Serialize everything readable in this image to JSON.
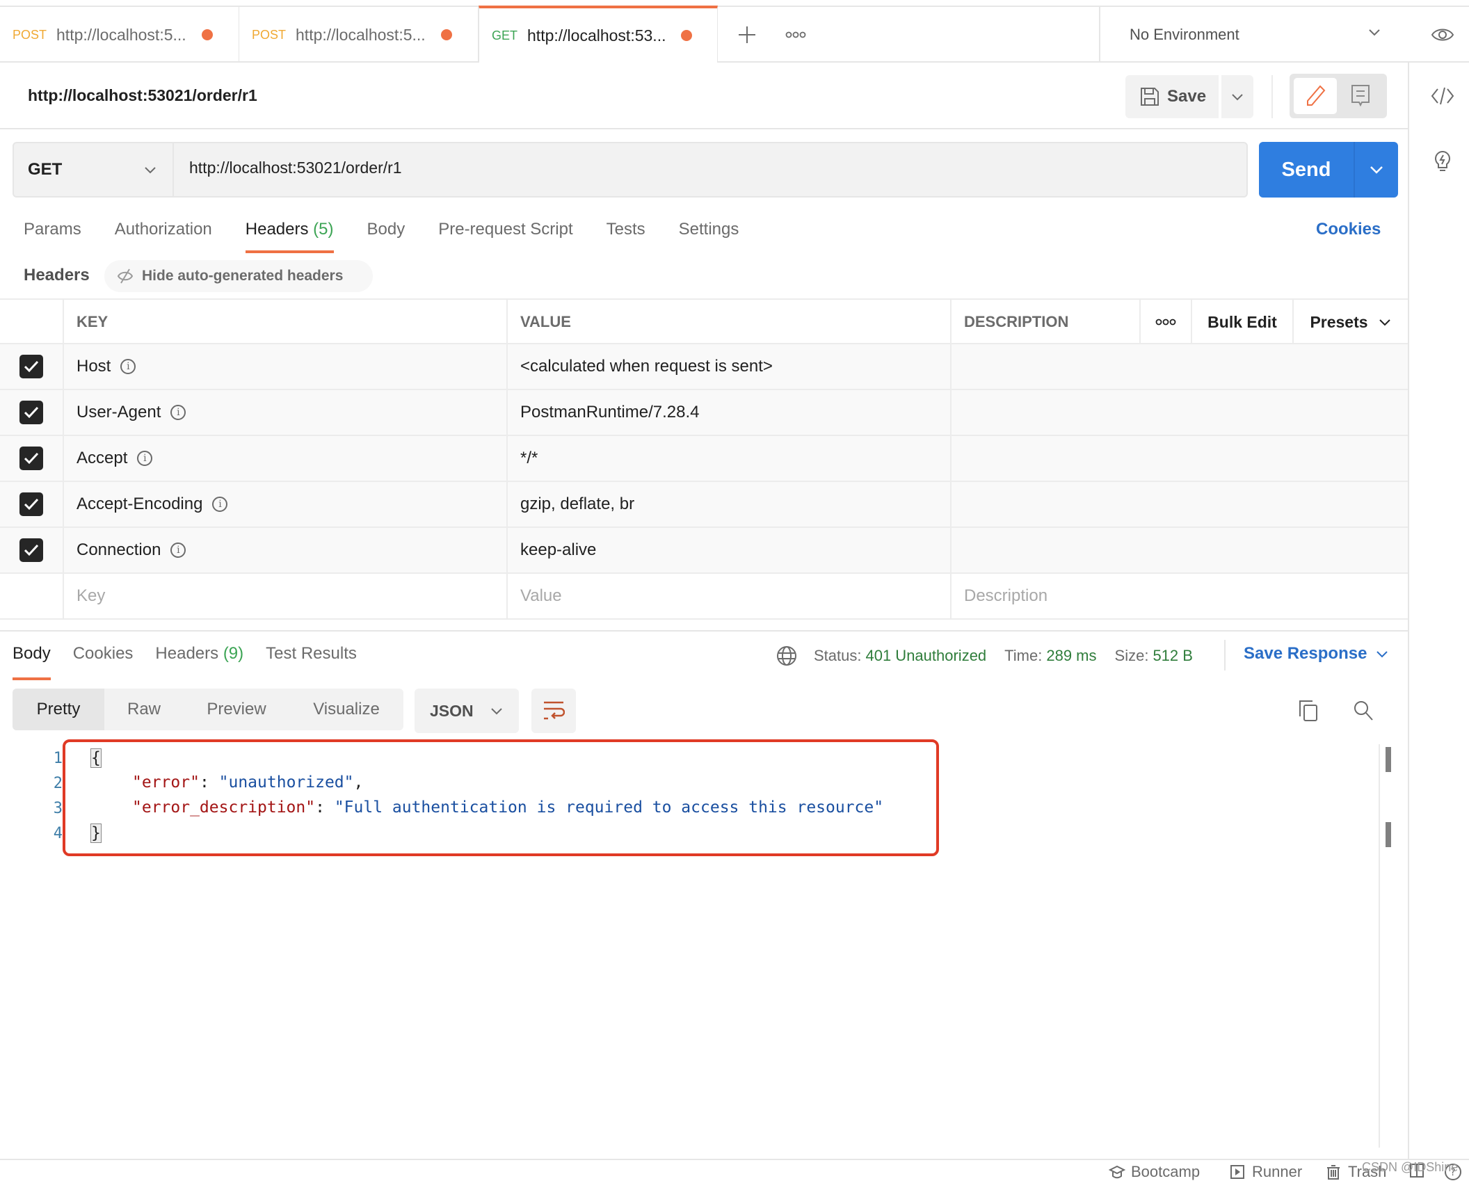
{
  "tabs": [
    {
      "method": "POST",
      "title": "http://localhost:5...",
      "unsaved": true,
      "active": false
    },
    {
      "method": "POST",
      "title": "http://localhost:5...",
      "unsaved": true,
      "active": false
    },
    {
      "method": "GET",
      "title": "http://localhost:53...",
      "unsaved": true,
      "active": true
    }
  ],
  "environment": {
    "selected": "No Environment"
  },
  "request": {
    "title": "http://localhost:53021/order/r1",
    "save_label": "Save",
    "method": "GET",
    "url": "http://localhost:53021/order/r1",
    "send_label": "Send",
    "tabs": [
      {
        "label": "Params"
      },
      {
        "label": "Authorization"
      },
      {
        "label": "Headers",
        "count": "(5)",
        "active": true
      },
      {
        "label": "Body"
      },
      {
        "label": "Pre-request Script"
      },
      {
        "label": "Tests"
      },
      {
        "label": "Settings"
      }
    ],
    "cookies_label": "Cookies",
    "headers_section_label": "Headers",
    "hide_auto_label": "Hide auto-generated headers"
  },
  "headers_table": {
    "columns": [
      "KEY",
      "VALUE",
      "DESCRIPTION"
    ],
    "bulk_edit_label": "Bulk Edit",
    "presets_label": "Presets",
    "rows": [
      {
        "checked": true,
        "key": "Host",
        "value": "<calculated when request is sent>",
        "description": ""
      },
      {
        "checked": true,
        "key": "User-Agent",
        "value": "PostmanRuntime/7.28.4",
        "description": ""
      },
      {
        "checked": true,
        "key": "Accept",
        "value": "*/*",
        "description": ""
      },
      {
        "checked": true,
        "key": "Accept-Encoding",
        "value": "gzip, deflate, br",
        "description": ""
      },
      {
        "checked": true,
        "key": "Connection",
        "value": "keep-alive",
        "description": ""
      }
    ],
    "placeholders": {
      "key": "Key",
      "value": "Value",
      "description": "Description"
    }
  },
  "response": {
    "tabs": [
      {
        "label": "Body",
        "active": true
      },
      {
        "label": "Cookies"
      },
      {
        "label": "Headers",
        "count": "(9)"
      },
      {
        "label": "Test Results"
      }
    ],
    "status_label": "Status:",
    "status": "401 Unauthorized",
    "time_label": "Time:",
    "time": "289 ms",
    "size_label": "Size:",
    "size": "512 B",
    "save_response_label": "Save Response",
    "view_modes": [
      "Pretty",
      "Raw",
      "Preview",
      "Visualize"
    ],
    "format": "JSON",
    "body_lines": [
      {
        "n": "1",
        "text": "{"
      },
      {
        "n": "2",
        "key": "\"error\"",
        "value": "\"unauthorized\"",
        "trail": ","
      },
      {
        "n": "3",
        "key": "\"error_description\"",
        "value": "\"Full authentication is required to access this resource\"",
        "trail": ""
      },
      {
        "n": "4",
        "text": "}"
      }
    ]
  },
  "footer": {
    "items": [
      "Bootcamp",
      "Runner",
      "Trash"
    ],
    "watermark": "CSDN @IDShine"
  },
  "colors": {
    "accent": "#ef7144",
    "send": "#2f7ee0",
    "link": "#2a6ec7",
    "status_ok": "#2f7d3b",
    "highlight_box": "#e03a25"
  }
}
